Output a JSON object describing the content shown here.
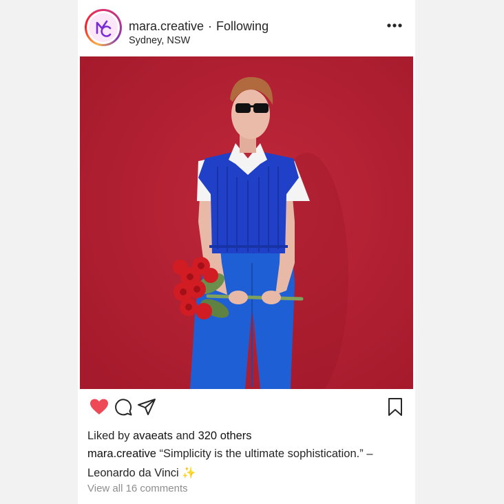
{
  "post": {
    "username": "mara.creative",
    "separator": "·",
    "follow_status": "Following",
    "location": "Sydney, NSW"
  },
  "icons": {
    "avatar": "mc-logo-avatar",
    "more": "more-options-icon",
    "like": "heart-icon",
    "comment": "comment-icon",
    "share": "share-icon",
    "save": "bookmark-icon"
  },
  "colors": {
    "photo_background": "#b51f33",
    "like_active": "#ed4956",
    "text": "#262626",
    "muted": "#8e8e8e"
  },
  "likes": {
    "prefix": "Liked by",
    "user": "avaeats",
    "joiner": "and",
    "count_text": "320 others"
  },
  "caption": {
    "username": "mara.creative",
    "text": "“Simplicity is the ultimate sophistication.” – Leonardo da Vinci ✨"
  },
  "comments": {
    "view_all": "View all 16 comments"
  }
}
